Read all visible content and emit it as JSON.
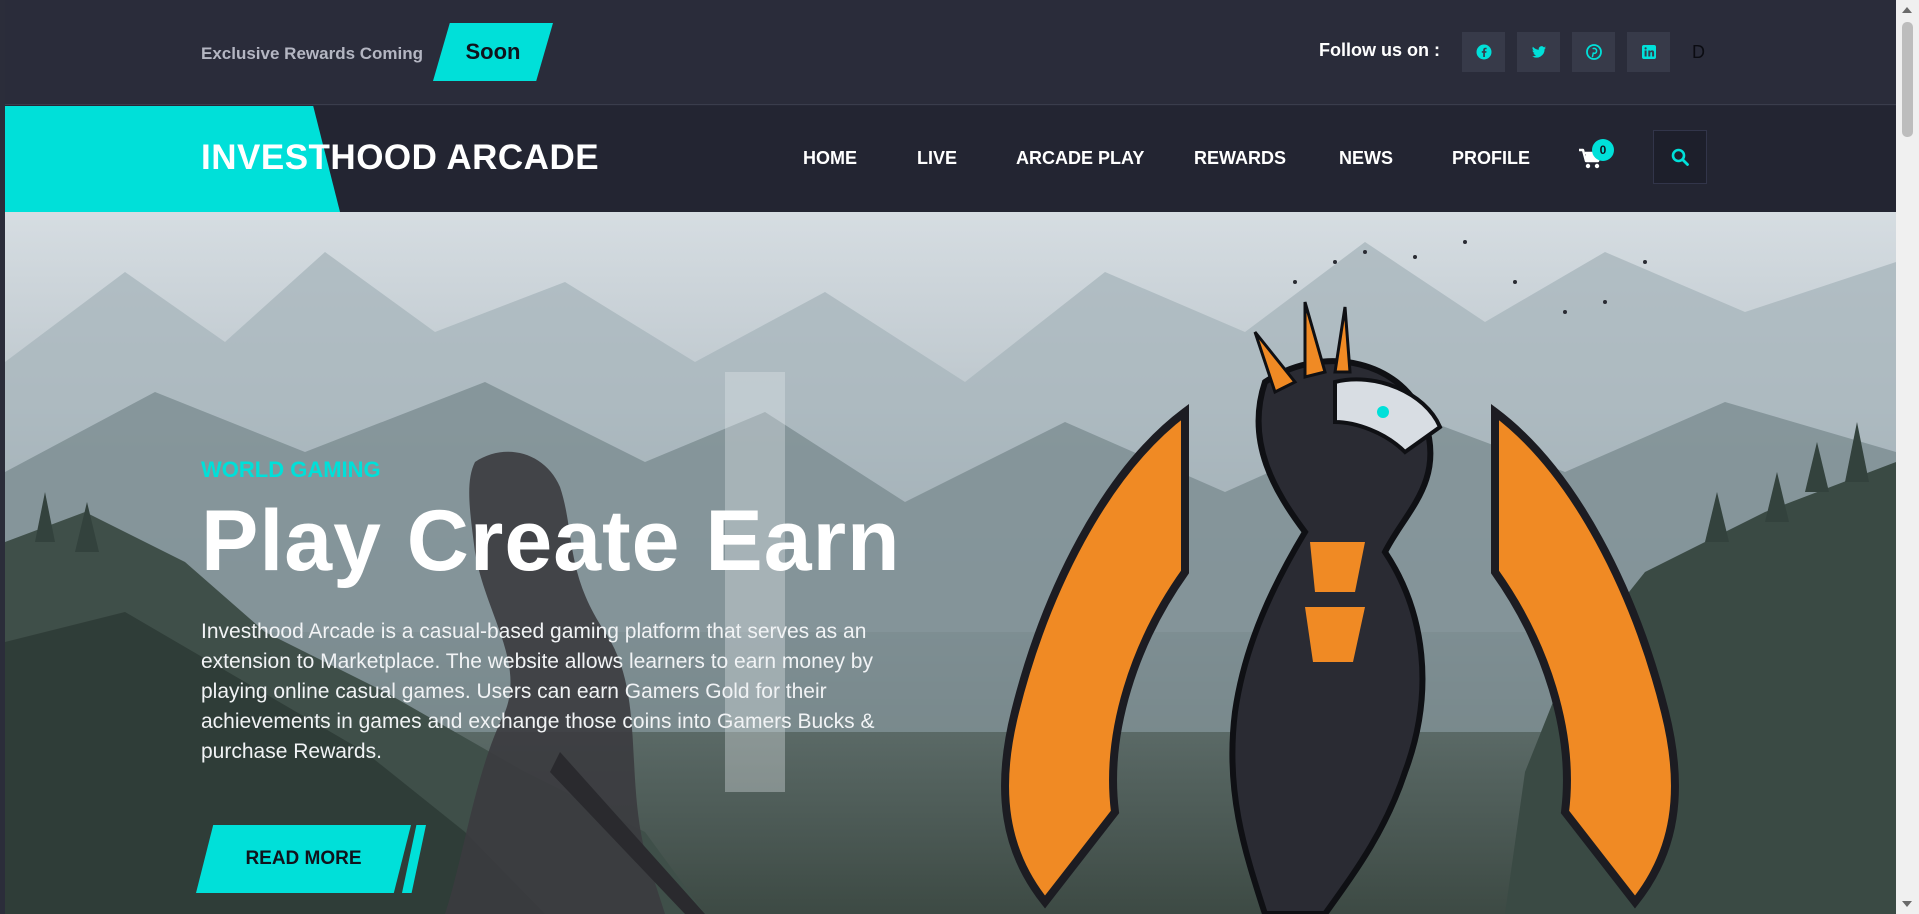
{
  "topbar": {
    "promo_text": "Exclusive Rewards Coming",
    "promo_badge": "Soon",
    "follow_label": "Follow us on :",
    "social": [
      "facebook-icon",
      "twitter-icon",
      "pinterest-icon",
      "linkedin-icon"
    ],
    "extra": "D"
  },
  "nav": {
    "logo": "INVESTHOOD ARCADE",
    "items": [
      "HOME",
      "LIVE",
      "ARCADE PLAY",
      "REWARDS",
      "NEWS",
      "PROFILE"
    ],
    "cart_count": "0"
  },
  "hero": {
    "kicker": "WORLD GAMING",
    "headline": "Play Create Earn",
    "description": "Investhood Arcade is a casual-based gaming platform that serves as an extension to Marketplace. The website allows learners to earn money by playing online casual games. Users can earn Gamers Gold for their achievements in games and exchange those coins into Gamers Bucks & purchase Rewards.",
    "cta": "READ MORE"
  },
  "colors": {
    "accent": "#00e0d9",
    "topbar_bg": "#2a2c3a",
    "nav_bg": "#232532"
  }
}
